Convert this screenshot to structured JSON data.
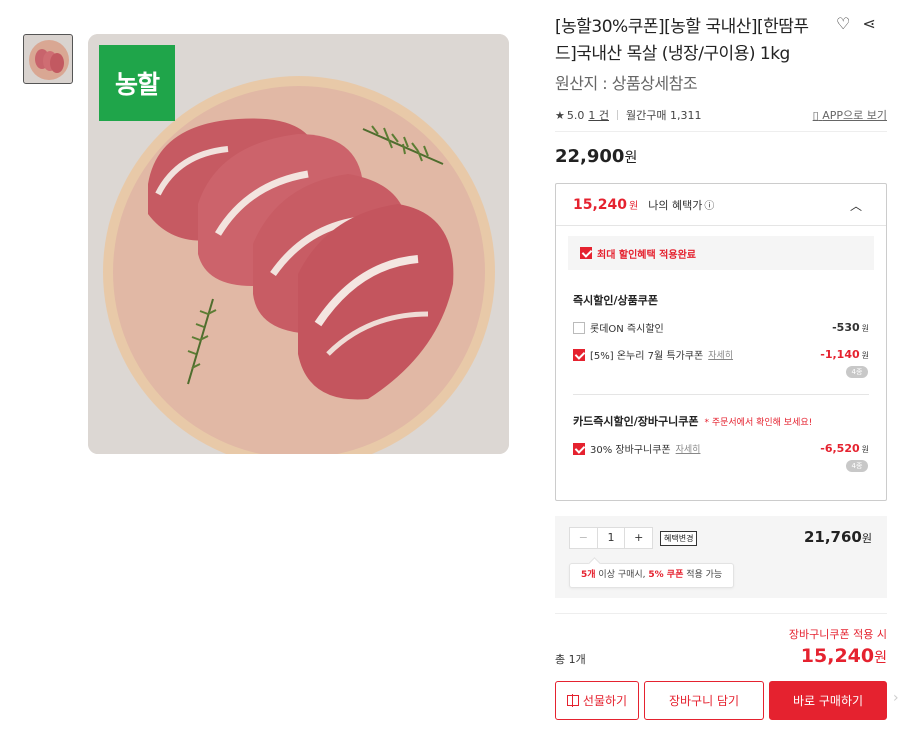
{
  "brand": {
    "badge_text": "농할",
    "badge_color": "#1fa54a"
  },
  "product": {
    "title": "[농할30%쿠폰][농할 국내산][한땀푸드]국내산 목살 (냉장/구이용) 1kg",
    "origin": "원산지 : 상품상세참조"
  },
  "header_icons": [
    "heart-icon",
    "share-icon"
  ],
  "rating": {
    "score": "5.0",
    "review_count": "1 건",
    "monthly": "월간구매 1,311",
    "app_link": "APP으로 보기"
  },
  "price": {
    "value": "22,900",
    "unit": "원"
  },
  "benefits": {
    "best_price": "15,240",
    "best_unit": "원",
    "label": "나의 혜택가",
    "max_applied": "최대 할인혜택 적용완료",
    "instant_section": "즉시할인/상품쿠폰",
    "lotteon_label": "롯데ON 즉시할인",
    "lotteon_amount": "-530",
    "onnuri_label": "[5%] 온누리 7월 특가쿠폰",
    "onnuri_detail": "자세히",
    "onnuri_amount": "-1,140",
    "onnuri_pill": "4종",
    "card_section": "카드즉시할인/장바구니쿠폰",
    "card_note": "* 주문서에서 확인해 보세요!",
    "cart_label": "30% 장바구니쿠폰",
    "cart_detail": "자세히",
    "cart_amount": "-6,520",
    "cart_pill": "4종",
    "won": "원"
  },
  "quantity": {
    "value": "1",
    "change_label": "혜택변경",
    "line_price": "21,760",
    "unit": "원",
    "tip_count": "5개",
    "tip_mid": " 이상 구매시, ",
    "tip_coupon": "5% 쿠폰",
    "tip_end": " 적용 가능"
  },
  "summary": {
    "coupon_note": "장바구니쿠폰 적용 시",
    "total_label": "총 1개",
    "total_price": "15,240",
    "unit": "원"
  },
  "buttons": {
    "gift": "선물하기",
    "cart": "장바구니 담기",
    "buy": "바로 구매하기"
  },
  "colors": {
    "accent": "#e5222f",
    "brand_green": "#1fa54a"
  }
}
